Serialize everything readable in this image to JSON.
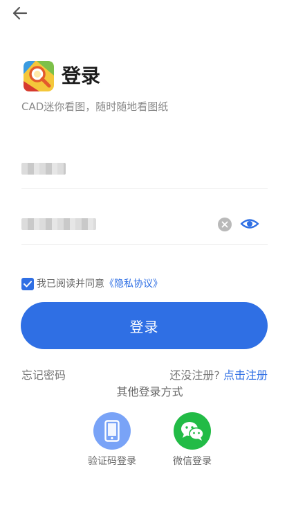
{
  "header": {
    "back_icon": "arrow-left-icon"
  },
  "brand": {
    "logo_icon": "cad-magnifier-logo-icon",
    "title": "登录",
    "subtitle": "CAD迷你看图，随时随地看图纸"
  },
  "form": {
    "username": {
      "value_obscured": true
    },
    "password": {
      "value_obscured": true,
      "clear_icon": "clear-circle-icon",
      "visibility_icon": "eye-icon"
    },
    "agreement": {
      "checked": true,
      "text": "我已阅读并同意",
      "link": "《隐私协议》"
    },
    "login_button": "登录"
  },
  "links": {
    "forgot_password": "忘记密码",
    "no_account": "还没注册?",
    "register": "点击注册"
  },
  "other_login": {
    "title": "其他登录方式",
    "methods": [
      {
        "label": "验证码登录",
        "icon": "phone-icon",
        "color": "#79a3f7"
      },
      {
        "label": "微信登录",
        "icon": "wechat-icon",
        "color": "#22bb46"
      }
    ]
  },
  "colors": {
    "accent": "#2f6fe4"
  }
}
